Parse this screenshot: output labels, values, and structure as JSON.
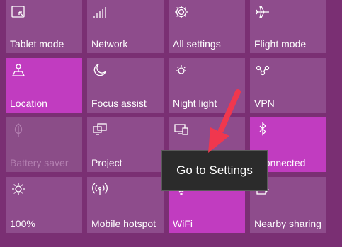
{
  "tiles": [
    {
      "label": "Tablet mode",
      "icon": "tablet-mode-icon",
      "state": "normal"
    },
    {
      "label": "Network",
      "icon": "network-icon",
      "state": "normal"
    },
    {
      "label": "All settings",
      "icon": "gear-icon",
      "state": "normal"
    },
    {
      "label": "Flight mode",
      "icon": "airplane-icon",
      "state": "normal"
    },
    {
      "label": "Location",
      "icon": "location-icon",
      "state": "active"
    },
    {
      "label": "Focus assist",
      "icon": "moon-icon",
      "state": "normal"
    },
    {
      "label": "Night light",
      "icon": "night-light-icon",
      "state": "normal"
    },
    {
      "label": "VPN",
      "icon": "vpn-icon",
      "state": "normal"
    },
    {
      "label": "Battery saver",
      "icon": "leaf-icon",
      "state": "disabled"
    },
    {
      "label": "Project",
      "icon": "project-icon",
      "state": "normal"
    },
    {
      "label": "",
      "icon": "connect-icon",
      "state": "normal"
    },
    {
      "label": "t connected",
      "icon": "bluetooth-icon",
      "state": "active"
    },
    {
      "label": "100%",
      "icon": "brightness-icon",
      "state": "normal"
    },
    {
      "label": "Mobile hotspot",
      "icon": "hotspot-icon",
      "state": "normal"
    },
    {
      "label": "WiFi",
      "icon": "wifi-icon",
      "state": "active"
    },
    {
      "label": "Nearby sharing",
      "icon": "share-icon",
      "state": "normal"
    }
  ],
  "tooltip": {
    "text": "Go to Settings"
  },
  "colors": {
    "background": "#7a2f73",
    "tile": "#8e4c8c",
    "tile_active": "#c13cc0",
    "tooltip_bg": "#2b2b2b",
    "arrow": "#f0374e"
  }
}
